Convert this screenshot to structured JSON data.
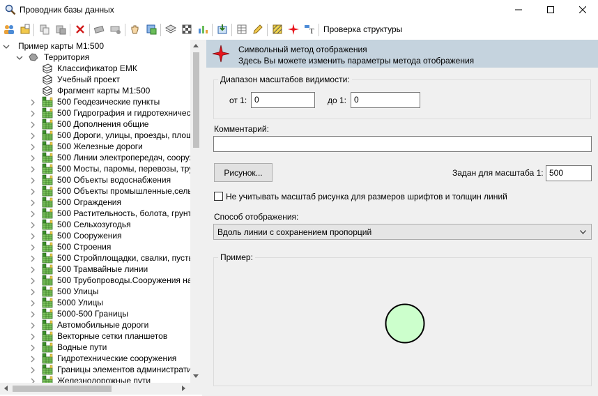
{
  "window": {
    "title": "Проводник базы данных"
  },
  "toolbar": {
    "check_structure_label": "Проверка структуры",
    "icons": [
      "users-icon",
      "new-folder-icon",
      "copy-icon",
      "paste-icon",
      "delete-icon",
      "cut-icon",
      "link-icon",
      "hand-icon",
      "add-layer-icon",
      "layers-icon",
      "texture-icon",
      "bar-chart-icon",
      "import-icon",
      "table-icon",
      "pencil-icon",
      "striped-box-icon",
      "symbol-icon",
      "text-format-icon"
    ]
  },
  "tree": {
    "root": "Пример карты М1:500",
    "territory": "Территория",
    "items": [
      {
        "label": "Классификатор ЕМК",
        "kind": "book"
      },
      {
        "label": "Учебный проект",
        "kind": "book"
      },
      {
        "label": "Фрагмент карты М1:500",
        "kind": "book"
      },
      {
        "label": "500 Геодезические пункты",
        "kind": "layer"
      },
      {
        "label": "500 Гидрография и гидротехничес",
        "kind": "layer"
      },
      {
        "label": "500 Дополнения общие",
        "kind": "layer"
      },
      {
        "label": "500 Дороги, улицы, проезды, площ",
        "kind": "layer"
      },
      {
        "label": "500 Железные дороги",
        "kind": "layer"
      },
      {
        "label": "500 Линии электропередач, сооруж",
        "kind": "layer"
      },
      {
        "label": "500 Мосты, паромы, перевозы, тру",
        "kind": "layer"
      },
      {
        "label": "500 Объекты водоснабжения",
        "kind": "layer"
      },
      {
        "label": "500 Объекты промышленные,сель",
        "kind": "layer"
      },
      {
        "label": "500 Ограждения",
        "kind": "layer"
      },
      {
        "label": "500 Растительность, болота, грунты",
        "kind": "layer"
      },
      {
        "label": "500 Сельхозугодья",
        "kind": "layer"
      },
      {
        "label": "500 Сооружения",
        "kind": "layer"
      },
      {
        "label": "500 Строения",
        "kind": "layer"
      },
      {
        "label": "500 Стройплощадки, свалки, пусть",
        "kind": "layer"
      },
      {
        "label": "500 Трамвайные линии",
        "kind": "layer"
      },
      {
        "label": "500 Трубопроводы.Сооружения на",
        "kind": "layer"
      },
      {
        "label": "500 Улицы",
        "kind": "layer"
      },
      {
        "label": "5000 Улицы",
        "kind": "layer"
      },
      {
        "label": "5000-500 Границы",
        "kind": "layer"
      },
      {
        "label": "Автомобильные дороги",
        "kind": "layer"
      },
      {
        "label": "Векторные сетки планшетов",
        "kind": "layer"
      },
      {
        "label": "Водные пути",
        "kind": "layer"
      },
      {
        "label": "Гидротехнические сооружения",
        "kind": "layer"
      },
      {
        "label": "Границы элементов административ",
        "kind": "layer"
      },
      {
        "label": "Железнодорожные пути",
        "kind": "layer"
      }
    ]
  },
  "header": {
    "title": "Символьный метод отображения",
    "subtitle": "Здесь Вы можете изменить параметры метода отображения"
  },
  "form": {
    "scale_range_legend": "Диапазон масштабов видимости:",
    "from_label": "от 1:",
    "from_value": "0",
    "to_label": "до 1:",
    "to_value": "0",
    "comment_label": "Комментарий:",
    "comment_value": "",
    "picture_button": "Рисунок...",
    "scale_set_label": "Задан для масштаба 1:",
    "scale_set_value": "500",
    "ignore_scale_label": "Не учитывать масштаб рисунка для размеров шрифтов и толщин линий",
    "ignore_scale_checked": false,
    "display_method_label": "Способ отображения:",
    "display_method_value": "Вдоль линии с сохранением пропорций",
    "example_legend": "Пример:"
  },
  "colors": {
    "banner": "#c5d3de",
    "preview_fill": "#ccffcc",
    "accent_red": "#e8141c"
  }
}
